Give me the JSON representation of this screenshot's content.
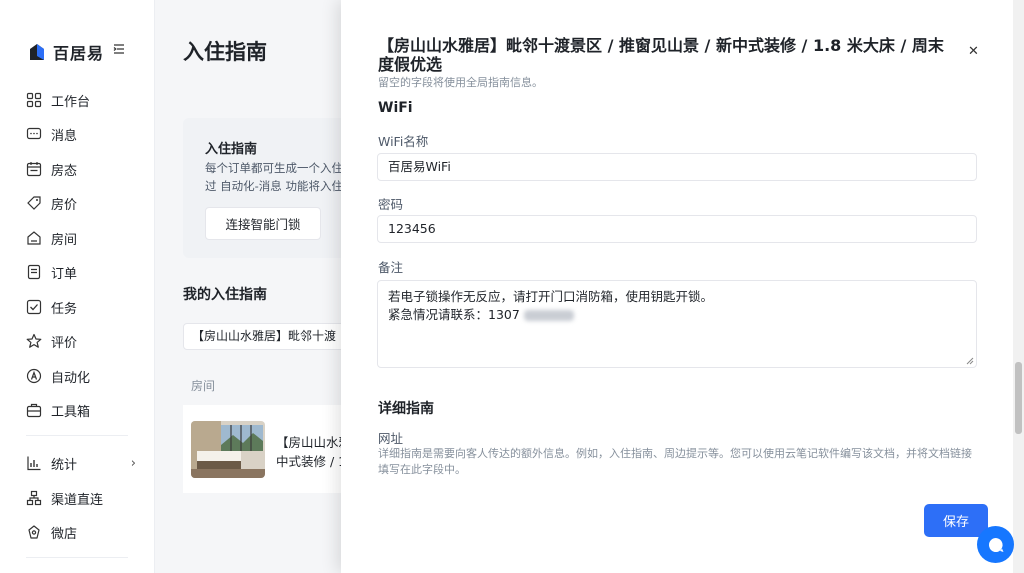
{
  "brand": {
    "name": "百居易",
    "accent": "#2d6ff7"
  },
  "sidebar": {
    "items": [
      {
        "label": "工作台",
        "icon": "dashboard-icon"
      },
      {
        "label": "消息",
        "icon": "message-icon"
      },
      {
        "label": "房态",
        "icon": "calendar-icon"
      },
      {
        "label": "房价",
        "icon": "price-tag-icon"
      },
      {
        "label": "房间",
        "icon": "home-icon"
      },
      {
        "label": "订单",
        "icon": "order-icon"
      },
      {
        "label": "任务",
        "icon": "task-icon"
      },
      {
        "label": "评价",
        "icon": "star-icon"
      },
      {
        "label": "自动化",
        "icon": "automation-icon"
      },
      {
        "label": "工具箱",
        "icon": "toolbox-icon"
      },
      {
        "label": "统计",
        "icon": "stats-icon"
      },
      {
        "label": "渠道直连",
        "icon": "channel-icon"
      },
      {
        "label": "微店",
        "icon": "shop-icon"
      }
    ]
  },
  "main": {
    "title": "入住指南",
    "card": {
      "heading": "入住指南",
      "line1": "每个订单都可生成一个入住",
      "line2": "过 自动化-消息 功能将入住",
      "button": "连接智能门锁"
    },
    "my_guides": "我的入住指南",
    "listing_select": "【房山山水雅居】毗邻十渡",
    "column_room": "房间",
    "row": {
      "line1": "【房山山水雅",
      "line2": "中式装修 / 1"
    }
  },
  "drawer": {
    "title": "【房山山水雅居】毗邻十渡景区 / 推窗见山景 / 新中式装修 / 1.8 米大床 / 周末度假优选",
    "hint": "留空的字段将使用全局指南信息。",
    "wifi_section": "WiFi",
    "wifi_name_label": "WiFi名称",
    "wifi_name_value": "百居易WiFi",
    "password_label": "密码",
    "password_value": "123456",
    "note_label": "备注",
    "note_line1": "若电子锁操作无反应，请打开门口消防箱，使用钥匙开锁。",
    "note_line2": "紧急情况请联系：1307",
    "detail_section": "详细指南",
    "url_label": "网址",
    "url_desc": "详细指南是需要向客人传达的额外信息。例如，入住指南、周边提示等。您可以使用云笔记软件编写该文档，并将文档链接填写在此字段中。",
    "save": "保存",
    "close_icon": "close-icon"
  }
}
